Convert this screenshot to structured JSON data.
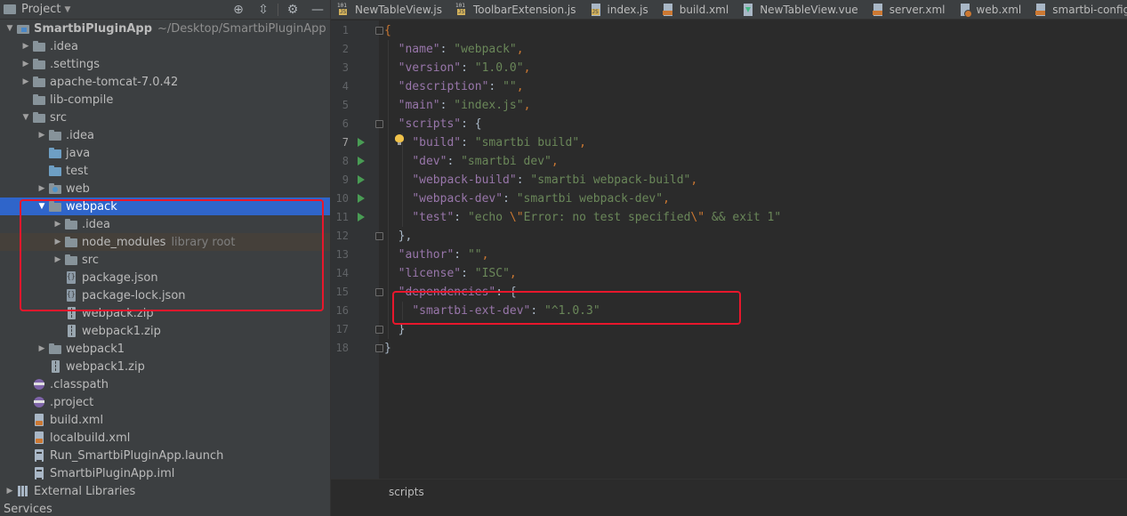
{
  "project_panel": {
    "title": "Project",
    "tools": [
      "crosshair-icon",
      "collapse-icon",
      "gear-icon",
      "minimize-icon"
    ],
    "tree": [
      {
        "level": 0,
        "arrow": "open",
        "icon": "module",
        "label": "SmartbiPluginApp",
        "path": "~/Desktop/SmartbiPluginApp",
        "bold": true
      },
      {
        "level": 1,
        "arrow": "closed",
        "icon": "folder",
        "label": ".idea"
      },
      {
        "level": 1,
        "arrow": "closed",
        "icon": "folder",
        "label": ".settings"
      },
      {
        "level": 1,
        "arrow": "closed",
        "icon": "folder",
        "label": "apache-tomcat-7.0.42"
      },
      {
        "level": 1,
        "arrow": "none",
        "icon": "folder",
        "label": "lib-compile"
      },
      {
        "level": 1,
        "arrow": "open",
        "icon": "folder",
        "label": "src"
      },
      {
        "level": 2,
        "arrow": "closed",
        "icon": "folder",
        "label": ".idea"
      },
      {
        "level": 2,
        "arrow": "none",
        "icon": "folder-blue",
        "label": "java"
      },
      {
        "level": 2,
        "arrow": "none",
        "icon": "folder-blue",
        "label": "test"
      },
      {
        "level": 2,
        "arrow": "closed",
        "icon": "folder-web",
        "label": "web"
      },
      {
        "level": 2,
        "arrow": "open",
        "icon": "folder",
        "label": "webpack",
        "selected": true
      },
      {
        "level": 3,
        "arrow": "closed",
        "icon": "folder",
        "label": ".idea"
      },
      {
        "level": 3,
        "arrow": "closed",
        "icon": "folder",
        "label": "node_modules",
        "extra": "library root",
        "libroot": true
      },
      {
        "level": 3,
        "arrow": "closed",
        "icon": "folder",
        "label": "src"
      },
      {
        "level": 3,
        "arrow": "none",
        "icon": "json",
        "label": "package.json"
      },
      {
        "level": 3,
        "arrow": "none",
        "icon": "json",
        "label": "package-lock.json"
      },
      {
        "level": 3,
        "arrow": "none",
        "icon": "zip",
        "label": "webpack.zip"
      },
      {
        "level": 3,
        "arrow": "none",
        "icon": "zip",
        "label": "webpack1.zip"
      },
      {
        "level": 2,
        "arrow": "closed",
        "icon": "folder",
        "label": "webpack1"
      },
      {
        "level": 2,
        "arrow": "none",
        "icon": "zip",
        "label": "webpack1.zip"
      },
      {
        "level": 1,
        "arrow": "none",
        "icon": "eclipse",
        "label": ".classpath"
      },
      {
        "level": 1,
        "arrow": "none",
        "icon": "eclipse",
        "label": ".project"
      },
      {
        "level": 1,
        "arrow": "none",
        "icon": "xml",
        "label": "build.xml"
      },
      {
        "level": 1,
        "arrow": "none",
        "icon": "xml",
        "label": "localbuild.xml"
      },
      {
        "level": 1,
        "arrow": "none",
        "icon": "file",
        "label": "Run_SmartbiPluginApp.launch"
      },
      {
        "level": 1,
        "arrow": "none",
        "icon": "file",
        "label": "SmartbiPluginApp.iml"
      },
      {
        "level": 0,
        "arrow": "closed",
        "icon": "libs",
        "label": "External Libraries"
      }
    ],
    "services_label": "Services"
  },
  "tabs": [
    {
      "label": "NewTableView.js",
      "icon": "js101"
    },
    {
      "label": "ToolbarExtension.js",
      "icon": "js101"
    },
    {
      "label": "index.js",
      "icon": "js"
    },
    {
      "label": "build.xml",
      "icon": "xml"
    },
    {
      "label": "NewTableView.vue",
      "icon": "vue"
    },
    {
      "label": "server.xml",
      "icon": "xml"
    },
    {
      "label": "web.xml",
      "icon": "web"
    },
    {
      "label": "smartbi-config.",
      "icon": "xml"
    }
  ],
  "editor": {
    "current_line": 7,
    "run_lines": [
      7,
      8,
      9,
      10,
      11
    ],
    "fold_lines": [
      1,
      6,
      12,
      15,
      17,
      18
    ],
    "lines": [
      [
        {
          "t": "p",
          "v": "{"
        }
      ],
      [
        {
          "t": "w",
          "v": "  "
        },
        {
          "t": "k",
          "v": "\"name\""
        },
        {
          "t": "w",
          "v": ": "
        },
        {
          "t": "s",
          "v": "\"webpack\""
        },
        {
          "t": "p",
          "v": ","
        }
      ],
      [
        {
          "t": "w",
          "v": "  "
        },
        {
          "t": "k",
          "v": "\"version\""
        },
        {
          "t": "w",
          "v": ": "
        },
        {
          "t": "s",
          "v": "\"1.0.0\""
        },
        {
          "t": "p",
          "v": ","
        }
      ],
      [
        {
          "t": "w",
          "v": "  "
        },
        {
          "t": "k",
          "v": "\"description\""
        },
        {
          "t": "w",
          "v": ": "
        },
        {
          "t": "s",
          "v": "\"\""
        },
        {
          "t": "p",
          "v": ","
        }
      ],
      [
        {
          "t": "w",
          "v": "  "
        },
        {
          "t": "k",
          "v": "\"main\""
        },
        {
          "t": "w",
          "v": ": "
        },
        {
          "t": "s",
          "v": "\"index.js\""
        },
        {
          "t": "p",
          "v": ","
        }
      ],
      [
        {
          "t": "w",
          "v": "  "
        },
        {
          "t": "k",
          "v": "\"scripts\""
        },
        {
          "t": "w",
          "v": ": {"
        }
      ],
      [
        {
          "t": "w",
          "v": "    "
        },
        {
          "t": "k",
          "v": "\"build\""
        },
        {
          "t": "w",
          "v": ": "
        },
        {
          "t": "s",
          "v": "\"smartbi build\""
        },
        {
          "t": "p",
          "v": ","
        }
      ],
      [
        {
          "t": "w",
          "v": "    "
        },
        {
          "t": "k",
          "v": "\"dev\""
        },
        {
          "t": "w",
          "v": ": "
        },
        {
          "t": "s",
          "v": "\"smartbi dev\""
        },
        {
          "t": "p",
          "v": ","
        }
      ],
      [
        {
          "t": "w",
          "v": "    "
        },
        {
          "t": "k",
          "v": "\"webpack-build\""
        },
        {
          "t": "w",
          "v": ": "
        },
        {
          "t": "s",
          "v": "\"smartbi webpack-build\""
        },
        {
          "t": "p",
          "v": ","
        }
      ],
      [
        {
          "t": "w",
          "v": "    "
        },
        {
          "t": "k",
          "v": "\"webpack-dev\""
        },
        {
          "t": "w",
          "v": ": "
        },
        {
          "t": "s",
          "v": "\"smartbi webpack-dev\""
        },
        {
          "t": "p",
          "v": ","
        }
      ],
      [
        {
          "t": "w",
          "v": "    "
        },
        {
          "t": "k",
          "v": "\"test\""
        },
        {
          "t": "w",
          "v": ": "
        },
        {
          "t": "s",
          "v": "\"echo "
        },
        {
          "t": "esc",
          "v": "\\\""
        },
        {
          "t": "s",
          "v": "Error: no test specified"
        },
        {
          "t": "esc",
          "v": "\\\""
        },
        {
          "t": "s",
          "v": " && exit 1\""
        }
      ],
      [
        {
          "t": "w",
          "v": "  },"
        }
      ],
      [
        {
          "t": "w",
          "v": "  "
        },
        {
          "t": "k",
          "v": "\"author\""
        },
        {
          "t": "w",
          "v": ": "
        },
        {
          "t": "s",
          "v": "\"\""
        },
        {
          "t": "p",
          "v": ","
        }
      ],
      [
        {
          "t": "w",
          "v": "  "
        },
        {
          "t": "k",
          "v": "\"license\""
        },
        {
          "t": "w",
          "v": ": "
        },
        {
          "t": "s",
          "v": "\"ISC\""
        },
        {
          "t": "p",
          "v": ","
        }
      ],
      [
        {
          "t": "w",
          "v": "  "
        },
        {
          "t": "k",
          "v": "\"dependencies\""
        },
        {
          "t": "w",
          "v": ": {"
        }
      ],
      [
        {
          "t": "w",
          "v": "    "
        },
        {
          "t": "k",
          "v": "\"smartbi-ext-dev\""
        },
        {
          "t": "w",
          "v": ": "
        },
        {
          "t": "s",
          "v": "\"^1.0.3\""
        }
      ],
      [
        {
          "t": "w",
          "v": "  }"
        }
      ],
      [
        {
          "t": "w",
          "v": "}"
        }
      ]
    ],
    "breadcrumb": "scripts"
  },
  "colors": {
    "selection": "#2f65ca",
    "highlight_box": "#e8172c",
    "json_key": "#9876aa",
    "json_string": "#6a8759",
    "json_punct": "#cc7832"
  }
}
